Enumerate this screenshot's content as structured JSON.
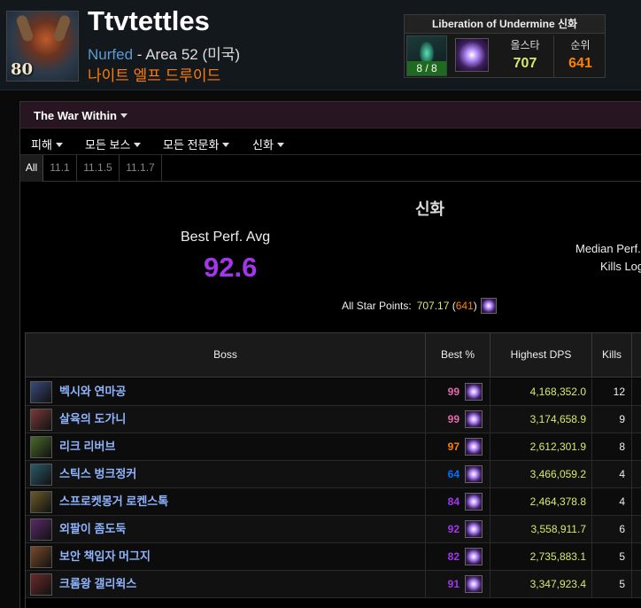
{
  "character": {
    "name": "Ttvtettles",
    "level": "80",
    "guild": "Nurfed",
    "server_sep": " - Area 52 (미국)",
    "class_spec": "나이트 엘프 드루이드"
  },
  "zone_summary": {
    "title": "Liberation of Undermine 신화",
    "progress": "8 / 8",
    "allstar_label": "올스타",
    "allstar_value": "707",
    "rank_label": "순위",
    "rank_value": "641"
  },
  "toolbar": {
    "expansion": "The War Within",
    "filters": [
      "피해",
      "모든 보스",
      "모든 전문화",
      "신화"
    ]
  },
  "partitions": [
    "All",
    "11.1",
    "11.1.5",
    "11.1.7"
  ],
  "summary": {
    "difficulty": "신화",
    "best_perf_label": "Best Perf. Avg",
    "best_perf_value": "92.6",
    "median_label": "Median Perf.",
    "kills_label": "Kills Log",
    "allstar_label": "All Star Points:",
    "allstar_points": "707.17",
    "allstar_open": " (",
    "allstar_rank": "641",
    "allstar_close": ")"
  },
  "table": {
    "headers": [
      "Boss",
      "Best %",
      "Highest DPS",
      "Kills"
    ],
    "rows": [
      {
        "boss": "벡시와 연마공",
        "best": "99",
        "tier": "pink",
        "dps": "4,168,352.0",
        "kills": "12",
        "icon_color": "#3a4a7a"
      },
      {
        "boss": "살육의 도가니",
        "best": "99",
        "tier": "pink",
        "dps": "3,174,658.9",
        "kills": "9",
        "icon_color": "#7a3a3a"
      },
      {
        "boss": "리크 리버브",
        "best": "97",
        "tier": "legendary",
        "dps": "2,612,301.9",
        "kills": "8",
        "icon_color": "#4a6a2a"
      },
      {
        "boss": "스틱스 벙크정커",
        "best": "64",
        "tier": "blue",
        "dps": "3,466,059.2",
        "kills": "4",
        "icon_color": "#2a5a6a"
      },
      {
        "boss": "스프로켓몽거 로켄스톡",
        "best": "84",
        "tier": "ep",
        "dps": "2,464,378.8",
        "kills": "4",
        "icon_color": "#6a5a2a"
      },
      {
        "boss": "외팔이 좀도둑",
        "best": "92",
        "tier": "ep",
        "dps": "3,558,911.7",
        "kills": "6",
        "icon_color": "#5a2a6a"
      },
      {
        "boss": "보안 책임자 머그지",
        "best": "82",
        "tier": "ep",
        "dps": "2,735,883.1",
        "kills": "5",
        "icon_color": "#7a4a2a"
      },
      {
        "boss": "크롬왕 갤리윅스",
        "best": "91",
        "tier": "ep",
        "dps": "3,347,923.4",
        "kills": "5",
        "icon_color": "#6a2a2a"
      }
    ]
  },
  "colors": {
    "epic": "#a335ee",
    "legendary": "#ff8000",
    "artifact_pink": "#e268a8",
    "rare_blue": "#0070ff",
    "dps_yellow": "#d8e96b",
    "boss_name": "#8fb5ff",
    "guild_blue": "#5a9bd4",
    "class_orange": "#ff7d0a",
    "progress_green": "#1f6a1f",
    "expansion_bar": "#271521"
  },
  "icons": {
    "mythic": "mythic-icon",
    "zone": "zone-icon",
    "caret": "chevron-down-icon",
    "boss": "boss-portrait-icon"
  }
}
